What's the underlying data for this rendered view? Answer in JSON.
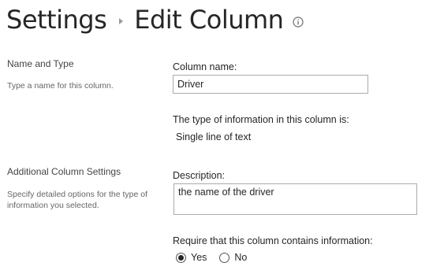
{
  "header": {
    "breadcrumb_root": "Settings",
    "page_title": "Edit Column",
    "info_icon": "info-circle-icon"
  },
  "sections": {
    "name_type": {
      "title": "Name and Type",
      "description": "Type a name for this column."
    },
    "additional": {
      "title": "Additional Column Settings",
      "description": "Specify detailed options for the type of information you selected."
    }
  },
  "fields": {
    "column_name_label": "Column name:",
    "column_name_value": "Driver",
    "type_label": "The type of information in this column is:",
    "type_value": "Single line of text",
    "description_label": "Description:",
    "description_value": "the name of the driver",
    "required_label": "Require that this column contains information:",
    "required_options": {
      "yes": "Yes",
      "no": "No"
    },
    "required_selected": "Yes"
  }
}
